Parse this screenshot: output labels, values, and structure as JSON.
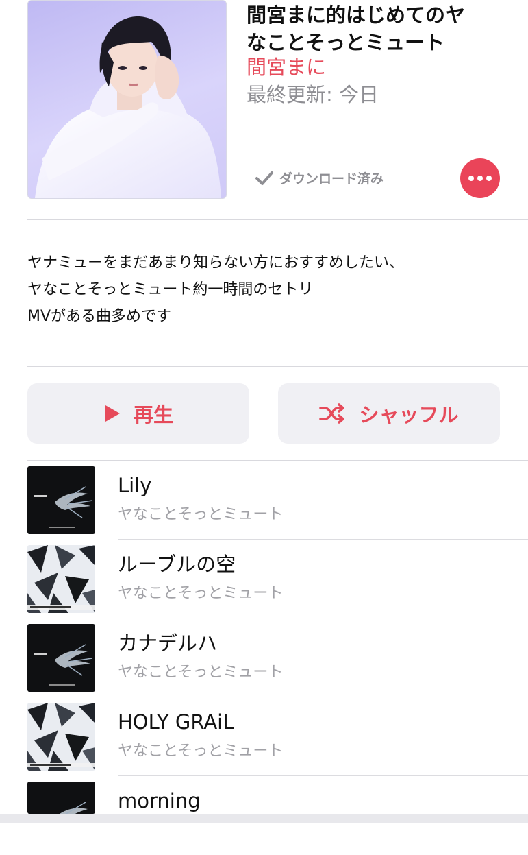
{
  "playlist": {
    "title": "間宮まに的はじめてのヤなことそっとミュート",
    "title_line1": "間宮まに的はじめてのヤ",
    "title_line2": "なことそっとミュート",
    "curator": "間宮まに",
    "updated": "最終更新: 今日",
    "download_status": "ダウンロード済み",
    "description_lines": [
      "ヤナミューをまだあまり知らない方におすすめしたい、",
      "ヤなことそっとミュート約一時間のセトリ",
      "MVがある曲多めです"
    ]
  },
  "actions": {
    "play_label": "再生",
    "shuffle_label": "シャッフル"
  },
  "tracks": [
    {
      "title": "Lily",
      "artist": "ヤなことそっとミュート",
      "art": "dark"
    },
    {
      "title": "ルーブルの空",
      "artist": "ヤなことそっとミュート",
      "art": "shards"
    },
    {
      "title": "カナデルハ",
      "artist": "ヤなことそっとミュート",
      "art": "dark"
    },
    {
      "title": "HOLY GRAiL",
      "artist": "ヤなことそっとミュート",
      "art": "shards"
    },
    {
      "title": "morning",
      "artist": "",
      "art": "dark"
    }
  ],
  "colors": {
    "accent": "#e64a5a",
    "secondary_text": "#8e8e93",
    "button_bg": "#f0f0f4"
  },
  "icons": {
    "check": "check-icon",
    "more": "more-icon",
    "play": "play-icon",
    "shuffle": "shuffle-icon"
  }
}
